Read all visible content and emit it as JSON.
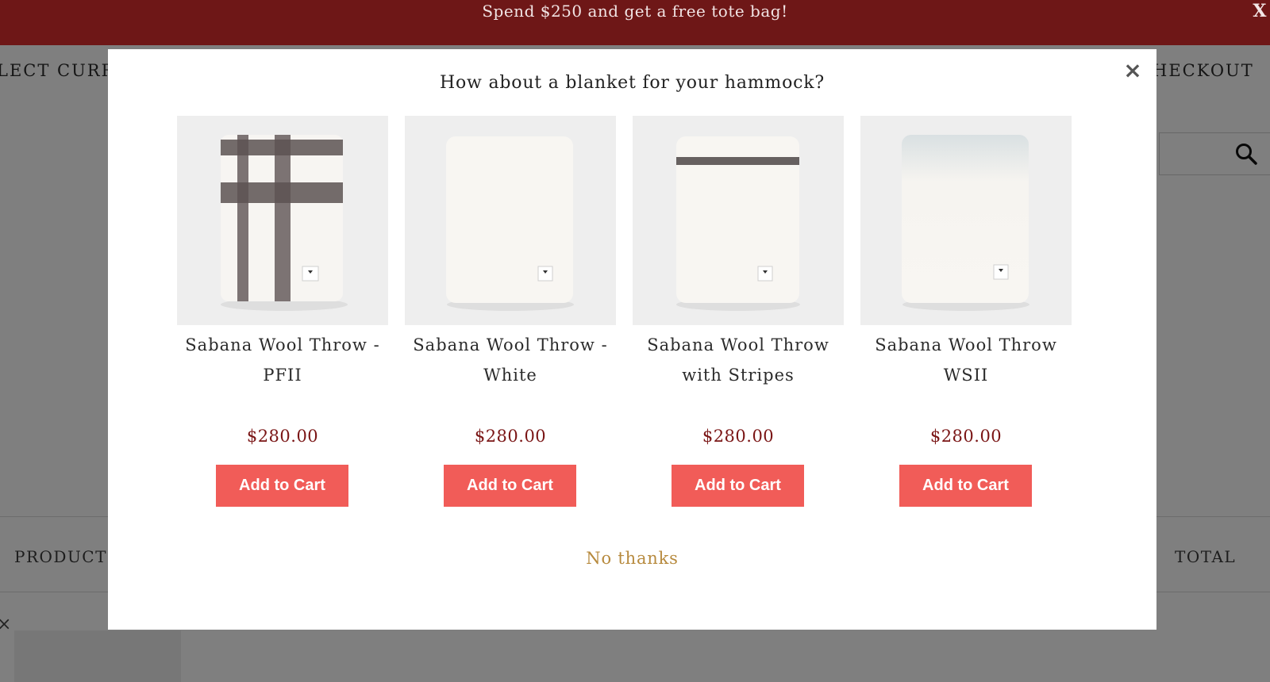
{
  "announcement": {
    "text": "Spend $250 and get a free tote bag!",
    "close_label": "X"
  },
  "header": {
    "currency_label": "LECT CURRENC",
    "checkout_label": "HECKOUT"
  },
  "cart_table": {
    "col_product": "PRODUCT",
    "col_total": "TOTAL",
    "remove_glyph": "×"
  },
  "modal": {
    "title": "How about a blanket for your hammock?",
    "close_glyph": "×",
    "decline_label": "No thanks",
    "products": [
      {
        "name_line1": "Sabana Wool Throw -",
        "name_line2": "PFII",
        "price": "$280.00",
        "button": "Add to Cart",
        "image": "plaid-blanket"
      },
      {
        "name_line1": "Sabana Wool Throw -",
        "name_line2": "White",
        "price": "$280.00",
        "button": "Add to Cart",
        "image": "white-blanket"
      },
      {
        "name_line1": "Sabana Wool Throw",
        "name_line2": "with Stripes",
        "price": "$280.00",
        "button": "Add to Cart",
        "image": "striped-blanket"
      },
      {
        "name_line1": "Sabana Wool Throw",
        "name_line2": "WSII",
        "price": "$280.00",
        "button": "Add to Cart",
        "image": "ombre-blanket"
      }
    ]
  },
  "colors": {
    "announcement_bg": "#6e1717",
    "price": "#7a1515",
    "button": "#f15c58",
    "decline_link": "#b78a3e"
  }
}
